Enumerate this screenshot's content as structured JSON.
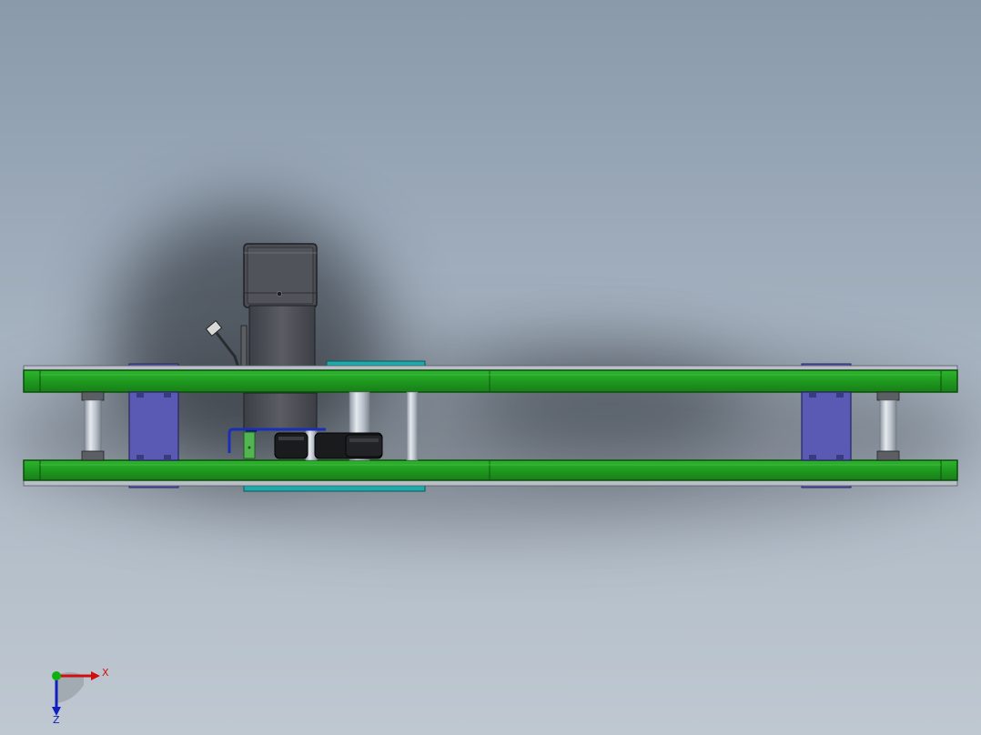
{
  "triad": {
    "x_label": "X",
    "z_label": "Z",
    "x_color": "#d01010",
    "y_color": "#10b010",
    "z_color": "#1020c0"
  },
  "colors": {
    "pcb_green": "#21a421",
    "pcb_edge": "#0b4f0b",
    "bracket_purple": "#5a5ab4",
    "teal_module": "#1eaaaa",
    "motor_grey": "#4b4e54",
    "rod_light": "#c9cfd8",
    "cable_blue": "#1a2fb8",
    "spacer_dark": "#5b5e62"
  },
  "icons": [
    "axis-triad-icon"
  ]
}
